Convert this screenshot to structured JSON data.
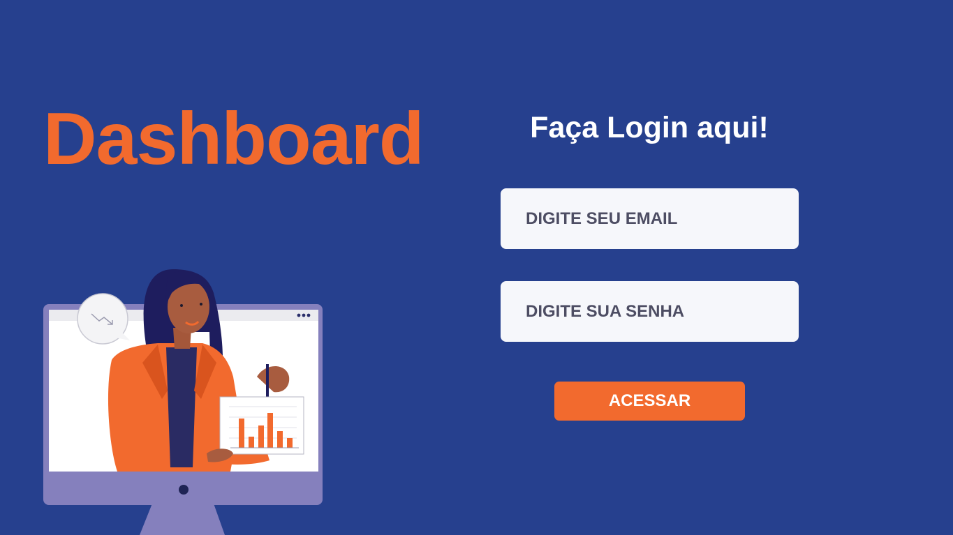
{
  "brand": {
    "title": "Dashboard"
  },
  "login": {
    "title": "Faça Login aqui!",
    "email_placeholder": "DIGITE SEU EMAIL",
    "password_placeholder": "DIGITE SUA SENHA",
    "submit_label": "ACESSAR"
  },
  "illustration": {
    "description_icon": "woman-presenting-chart-icon"
  },
  "colors": {
    "background": "#26408e",
    "accent": "#f26a2e",
    "field_bg": "#f6f7fb",
    "field_text": "#4d4d63",
    "monitor": "#8580bd"
  }
}
